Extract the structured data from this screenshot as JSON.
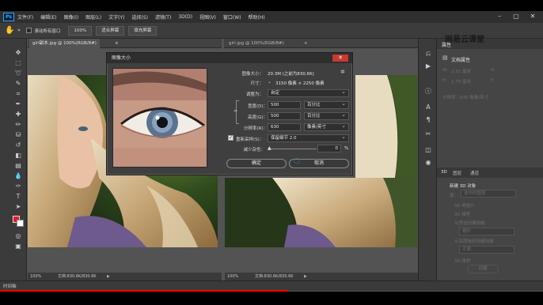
{
  "menubar": {
    "logo": "Ps",
    "items": [
      "文件(F)",
      "编辑(E)",
      "图像(I)",
      "图层(L)",
      "文字(Y)",
      "选择(S)",
      "滤镜(T)",
      "3D(D)",
      "视图(V)",
      "窗口(W)",
      "帮助(H)"
    ],
    "controls": [
      "–",
      "▢",
      "✕"
    ]
  },
  "options": {
    "scroll_all": "滚动所有窗口",
    "zoom": "100%",
    "fit_screen": "适合屏幕",
    "fill_screen": "填充屏幕"
  },
  "tabs": {
    "left": "girl副本.jpg @ 100%(RGB/8#)",
    "left_close": "×",
    "right": "girl.jpg @ 100%(RGB/8#)",
    "right_close": "×"
  },
  "status": {
    "left_zoom": "100%",
    "left_doc": "文档:830.6K/830.6K",
    "right_zoom": "100%",
    "right_doc": "文档:830.6K/830.6K",
    "timeline": "时间轴"
  },
  "watermark": "网易云课堂",
  "dialog": {
    "title": "图像大小",
    "close": "✕",
    "size_label": "图像大小：",
    "size_value": "20.3M (之前为830.6K)",
    "dims_label": "尺寸：",
    "dims_value": "3150 像素 × 2250 像素",
    "fit_label": "调整为：",
    "fit_value": "自定",
    "width_label": "宽度(D)：",
    "width_value": "500",
    "width_unit": "百分比",
    "height_label": "高度(G)：",
    "height_value": "500",
    "height_unit": "百分比",
    "res_label": "分辨率(R)：",
    "res_value": "630",
    "res_unit": "像素/英寸",
    "resample_label": "重新采样(S)：",
    "resample_value": "保留细节 2.0",
    "noise_label": "减少杂色：",
    "noise_value": "0",
    "noise_unit": "%",
    "ok": "确定",
    "cancel": "取消"
  },
  "properties": {
    "tab": "属性",
    "doc_props": "文档属性",
    "w_label": "W:",
    "w_value": "2.51 厘米",
    "h_label": "H:",
    "h_value": "1.79 厘米",
    "x_label": "X:",
    "y_label": "Y:",
    "res_line": "分辨率：630 像素/英寸"
  },
  "panel3d": {
    "tabs": [
      "3D",
      "图层",
      "通道"
    ],
    "title": "新建 3D 对象",
    "source_label": "源：",
    "source_value": "选中的图层",
    "opt_postcard": "3D 明信片",
    "opt_model": "3D 模型",
    "opt_preset": "从预设创建网格",
    "preset_value": "帽形",
    "opt_depth": "从深度映射创建网格",
    "depth_value": "平面",
    "opt_volume": "3D 体积",
    "create": "创建"
  },
  "progress": {
    "fraction": 0.53,
    "color": "#ff0000"
  },
  "colors": {
    "foreground": "#e31b23",
    "background": "#ffffff",
    "accent": "#31a8ff"
  }
}
